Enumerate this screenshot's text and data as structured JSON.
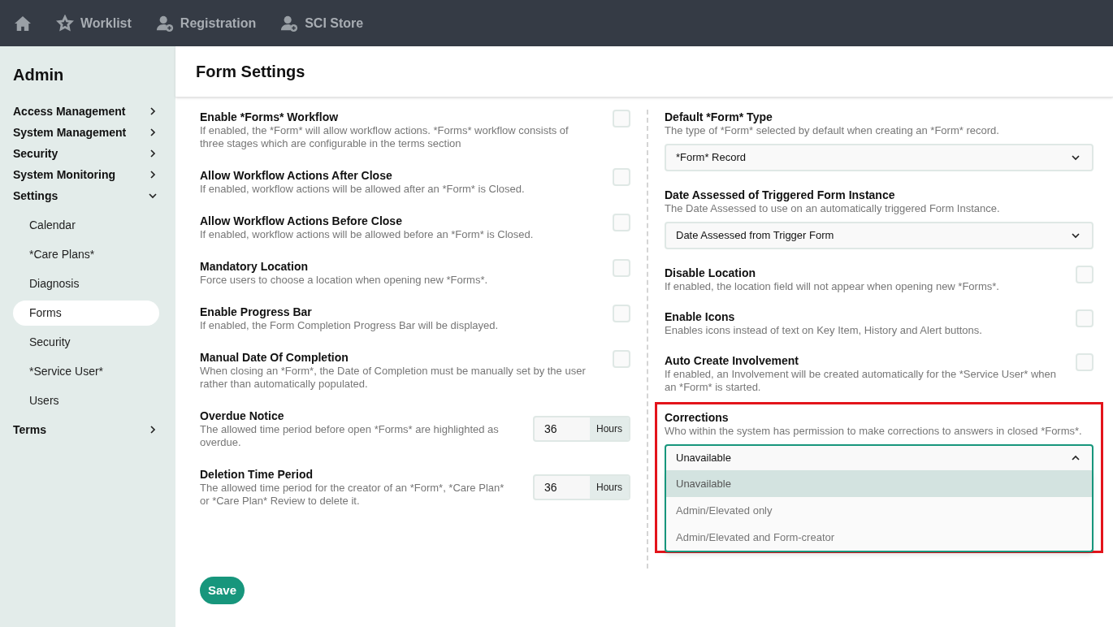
{
  "topnav": [
    {
      "kind": "home"
    },
    {
      "kind": "star",
      "label": "Worklist"
    },
    {
      "kind": "user-add",
      "label": "Registration"
    },
    {
      "kind": "user-add",
      "label": "SCI Store"
    }
  ],
  "sidebar": {
    "title": "Admin",
    "items": [
      {
        "label": "Access Management",
        "expanded": false
      },
      {
        "label": "System Management",
        "expanded": false
      },
      {
        "label": "Security",
        "expanded": false
      },
      {
        "label": "System Monitoring",
        "expanded": false
      },
      {
        "label": "Settings",
        "expanded": true,
        "children": [
          {
            "label": "Calendar",
            "selected": false
          },
          {
            "label": "*Care Plans*",
            "selected": false
          },
          {
            "label": "Diagnosis",
            "selected": false
          },
          {
            "label": "Forms",
            "selected": true
          },
          {
            "label": "Security",
            "selected": false
          },
          {
            "label": "*Service User*",
            "selected": false
          },
          {
            "label": "Users",
            "selected": false
          }
        ]
      },
      {
        "label": "Terms",
        "expanded": false
      }
    ]
  },
  "page_title": "Form Settings",
  "left_settings": [
    {
      "kind": "checkbox",
      "title": "Enable *Forms* Workflow",
      "description": "If enabled, the *Form* will allow workflow actions. *Forms* workflow consists of three stages which are configurable in the terms section",
      "checked": false
    },
    {
      "kind": "checkbox",
      "title": "Allow Workflow Actions After Close",
      "description": "If enabled, workflow actions will be allowed after an *Form* is Closed.",
      "checked": false
    },
    {
      "kind": "checkbox",
      "title": "Allow Workflow Actions Before Close",
      "description": "If enabled, workflow actions will be allowed before an *Form* is Closed.",
      "checked": false
    },
    {
      "kind": "checkbox",
      "title": "Mandatory Location",
      "description": "Force users to choose a location when opening new *Forms*.",
      "checked": false
    },
    {
      "kind": "checkbox",
      "title": "Enable Progress Bar",
      "description": "If enabled, the Form Completion Progress Bar will be displayed.",
      "checked": false
    },
    {
      "kind": "checkbox",
      "title": "Manual Date Of Completion",
      "description": "When closing an *Form*, the Date of Completion must be manually set by the user rather than automatically populated.",
      "checked": false
    },
    {
      "kind": "number",
      "title": "Overdue Notice",
      "description": "The allowed time period before open *Forms* are highlighted as overdue.",
      "value": "36",
      "unit": "Hours"
    },
    {
      "kind": "number",
      "title": "Deletion Time Period",
      "description": "The allowed time period for the creator of an *Form*, *Care Plan* or *Care Plan* Review to delete it.",
      "value": "36",
      "unit": "Hours"
    }
  ],
  "right_settings": [
    {
      "kind": "select",
      "title": "Default *Form* Type",
      "description": "The type of *Form* selected by default when creating an *Form* record.",
      "value": "*Form* Record",
      "open": false
    },
    {
      "kind": "select",
      "title": "Date Assessed of Triggered Form Instance",
      "description": "The Date Assessed to use on an automatically triggered Form Instance.",
      "value": "Date Assessed from Trigger Form",
      "open": false
    },
    {
      "kind": "checkbox",
      "title": "Disable Location",
      "description": "If enabled, the location field will not appear when opening new *Forms*.",
      "checked": false
    },
    {
      "kind": "checkbox",
      "title": "Enable Icons",
      "description": "Enables icons instead of text on Key Item, History and Alert buttons.",
      "checked": false
    },
    {
      "kind": "checkbox",
      "title": "Auto Create Involvement",
      "description": "If enabled, an Involvement will be created automatically for the *Service User* when an *Form* is started.",
      "checked": false
    },
    {
      "kind": "select",
      "title": "Corrections",
      "description": "Who within the system has permission to make corrections to answers in closed *Forms*.",
      "value": "Unavailable",
      "open": true,
      "highlighted": true,
      "options": [
        {
          "label": "Unavailable",
          "selected": true
        },
        {
          "label": "Admin/Elevated only",
          "selected": false
        },
        {
          "label": "Admin/Elevated and Form-creator",
          "selected": false
        }
      ]
    }
  ],
  "save_button": "Save"
}
